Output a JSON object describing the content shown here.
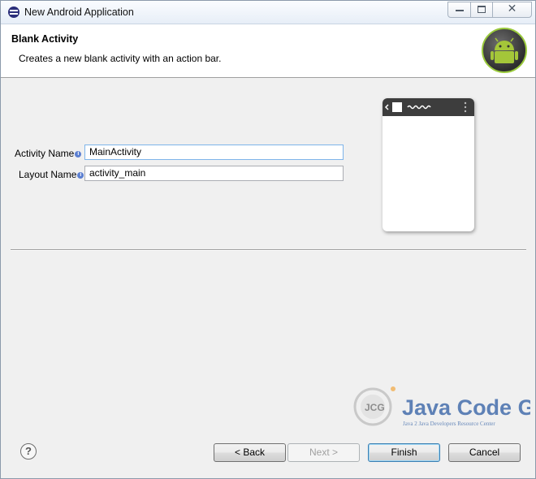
{
  "window": {
    "title": "New Android Application",
    "icon": "eclipse-icon",
    "controls": {
      "minimize": "minimize-icon",
      "maximize": "maximize-icon",
      "close": "close-icon"
    }
  },
  "banner": {
    "title": "Blank Activity",
    "description": "Creates a new blank activity with an action bar.",
    "logo": "android-logo-icon"
  },
  "form": {
    "activity_name_label": "Activity Name",
    "activity_name_value": "MainActivity",
    "layout_name_label": "Layout Name",
    "layout_name_value": "activity_main",
    "info_icon": "info-icon"
  },
  "preview": {
    "icon": "blank-activity-preview"
  },
  "watermark": {
    "logo_text": "JCG",
    "title": "Java Code Geeks",
    "subtitle": "Java 2 Java Developers Resource Center"
  },
  "footer": {
    "help_label": "?",
    "back_label": "< Back",
    "next_label": "Next >",
    "finish_label": "Finish",
    "cancel_label": "Cancel"
  },
  "colors": {
    "dialog_bg": "#f0f0f0",
    "focus_border": "#7eb4ea",
    "android_green": "#9aca3c",
    "watermark_blue": "#3a66a8",
    "watermark_orange": "#f19a1f"
  }
}
